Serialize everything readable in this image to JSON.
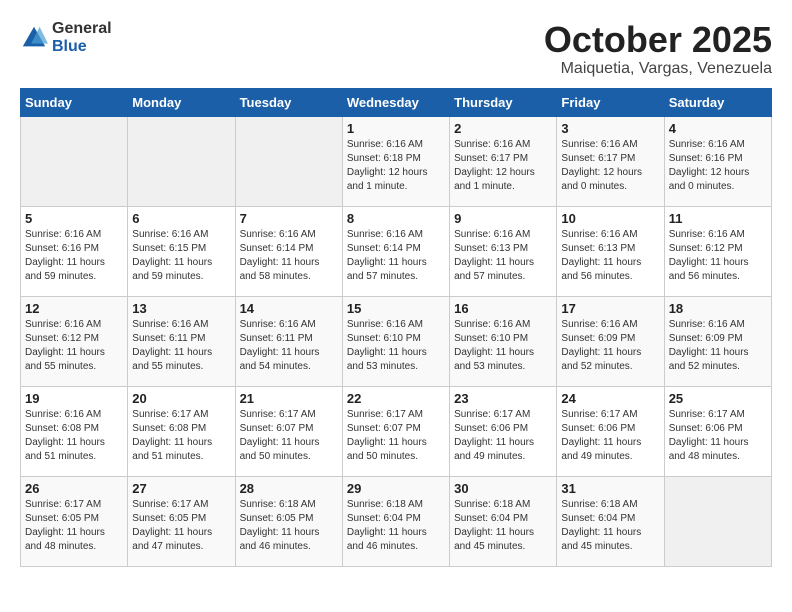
{
  "header": {
    "logo_general": "General",
    "logo_blue": "Blue",
    "month_title": "October 2025",
    "location": "Maiquetia, Vargas, Venezuela"
  },
  "weekdays": [
    "Sunday",
    "Monday",
    "Tuesday",
    "Wednesday",
    "Thursday",
    "Friday",
    "Saturday"
  ],
  "weeks": [
    [
      {
        "day": "",
        "info": ""
      },
      {
        "day": "",
        "info": ""
      },
      {
        "day": "",
        "info": ""
      },
      {
        "day": "1",
        "info": "Sunrise: 6:16 AM\nSunset: 6:18 PM\nDaylight: 12 hours\nand 1 minute."
      },
      {
        "day": "2",
        "info": "Sunrise: 6:16 AM\nSunset: 6:17 PM\nDaylight: 12 hours\nand 1 minute."
      },
      {
        "day": "3",
        "info": "Sunrise: 6:16 AM\nSunset: 6:17 PM\nDaylight: 12 hours\nand 0 minutes."
      },
      {
        "day": "4",
        "info": "Sunrise: 6:16 AM\nSunset: 6:16 PM\nDaylight: 12 hours\nand 0 minutes."
      }
    ],
    [
      {
        "day": "5",
        "info": "Sunrise: 6:16 AM\nSunset: 6:16 PM\nDaylight: 11 hours\nand 59 minutes."
      },
      {
        "day": "6",
        "info": "Sunrise: 6:16 AM\nSunset: 6:15 PM\nDaylight: 11 hours\nand 59 minutes."
      },
      {
        "day": "7",
        "info": "Sunrise: 6:16 AM\nSunset: 6:14 PM\nDaylight: 11 hours\nand 58 minutes."
      },
      {
        "day": "8",
        "info": "Sunrise: 6:16 AM\nSunset: 6:14 PM\nDaylight: 11 hours\nand 57 minutes."
      },
      {
        "day": "9",
        "info": "Sunrise: 6:16 AM\nSunset: 6:13 PM\nDaylight: 11 hours\nand 57 minutes."
      },
      {
        "day": "10",
        "info": "Sunrise: 6:16 AM\nSunset: 6:13 PM\nDaylight: 11 hours\nand 56 minutes."
      },
      {
        "day": "11",
        "info": "Sunrise: 6:16 AM\nSunset: 6:12 PM\nDaylight: 11 hours\nand 56 minutes."
      }
    ],
    [
      {
        "day": "12",
        "info": "Sunrise: 6:16 AM\nSunset: 6:12 PM\nDaylight: 11 hours\nand 55 minutes."
      },
      {
        "day": "13",
        "info": "Sunrise: 6:16 AM\nSunset: 6:11 PM\nDaylight: 11 hours\nand 55 minutes."
      },
      {
        "day": "14",
        "info": "Sunrise: 6:16 AM\nSunset: 6:11 PM\nDaylight: 11 hours\nand 54 minutes."
      },
      {
        "day": "15",
        "info": "Sunrise: 6:16 AM\nSunset: 6:10 PM\nDaylight: 11 hours\nand 53 minutes."
      },
      {
        "day": "16",
        "info": "Sunrise: 6:16 AM\nSunset: 6:10 PM\nDaylight: 11 hours\nand 53 minutes."
      },
      {
        "day": "17",
        "info": "Sunrise: 6:16 AM\nSunset: 6:09 PM\nDaylight: 11 hours\nand 52 minutes."
      },
      {
        "day": "18",
        "info": "Sunrise: 6:16 AM\nSunset: 6:09 PM\nDaylight: 11 hours\nand 52 minutes."
      }
    ],
    [
      {
        "day": "19",
        "info": "Sunrise: 6:16 AM\nSunset: 6:08 PM\nDaylight: 11 hours\nand 51 minutes."
      },
      {
        "day": "20",
        "info": "Sunrise: 6:17 AM\nSunset: 6:08 PM\nDaylight: 11 hours\nand 51 minutes."
      },
      {
        "day": "21",
        "info": "Sunrise: 6:17 AM\nSunset: 6:07 PM\nDaylight: 11 hours\nand 50 minutes."
      },
      {
        "day": "22",
        "info": "Sunrise: 6:17 AM\nSunset: 6:07 PM\nDaylight: 11 hours\nand 50 minutes."
      },
      {
        "day": "23",
        "info": "Sunrise: 6:17 AM\nSunset: 6:06 PM\nDaylight: 11 hours\nand 49 minutes."
      },
      {
        "day": "24",
        "info": "Sunrise: 6:17 AM\nSunset: 6:06 PM\nDaylight: 11 hours\nand 49 minutes."
      },
      {
        "day": "25",
        "info": "Sunrise: 6:17 AM\nSunset: 6:06 PM\nDaylight: 11 hours\nand 48 minutes."
      }
    ],
    [
      {
        "day": "26",
        "info": "Sunrise: 6:17 AM\nSunset: 6:05 PM\nDaylight: 11 hours\nand 48 minutes."
      },
      {
        "day": "27",
        "info": "Sunrise: 6:17 AM\nSunset: 6:05 PM\nDaylight: 11 hours\nand 47 minutes."
      },
      {
        "day": "28",
        "info": "Sunrise: 6:18 AM\nSunset: 6:05 PM\nDaylight: 11 hours\nand 46 minutes."
      },
      {
        "day": "29",
        "info": "Sunrise: 6:18 AM\nSunset: 6:04 PM\nDaylight: 11 hours\nand 46 minutes."
      },
      {
        "day": "30",
        "info": "Sunrise: 6:18 AM\nSunset: 6:04 PM\nDaylight: 11 hours\nand 45 minutes."
      },
      {
        "day": "31",
        "info": "Sunrise: 6:18 AM\nSunset: 6:04 PM\nDaylight: 11 hours\nand 45 minutes."
      },
      {
        "day": "",
        "info": ""
      }
    ]
  ]
}
